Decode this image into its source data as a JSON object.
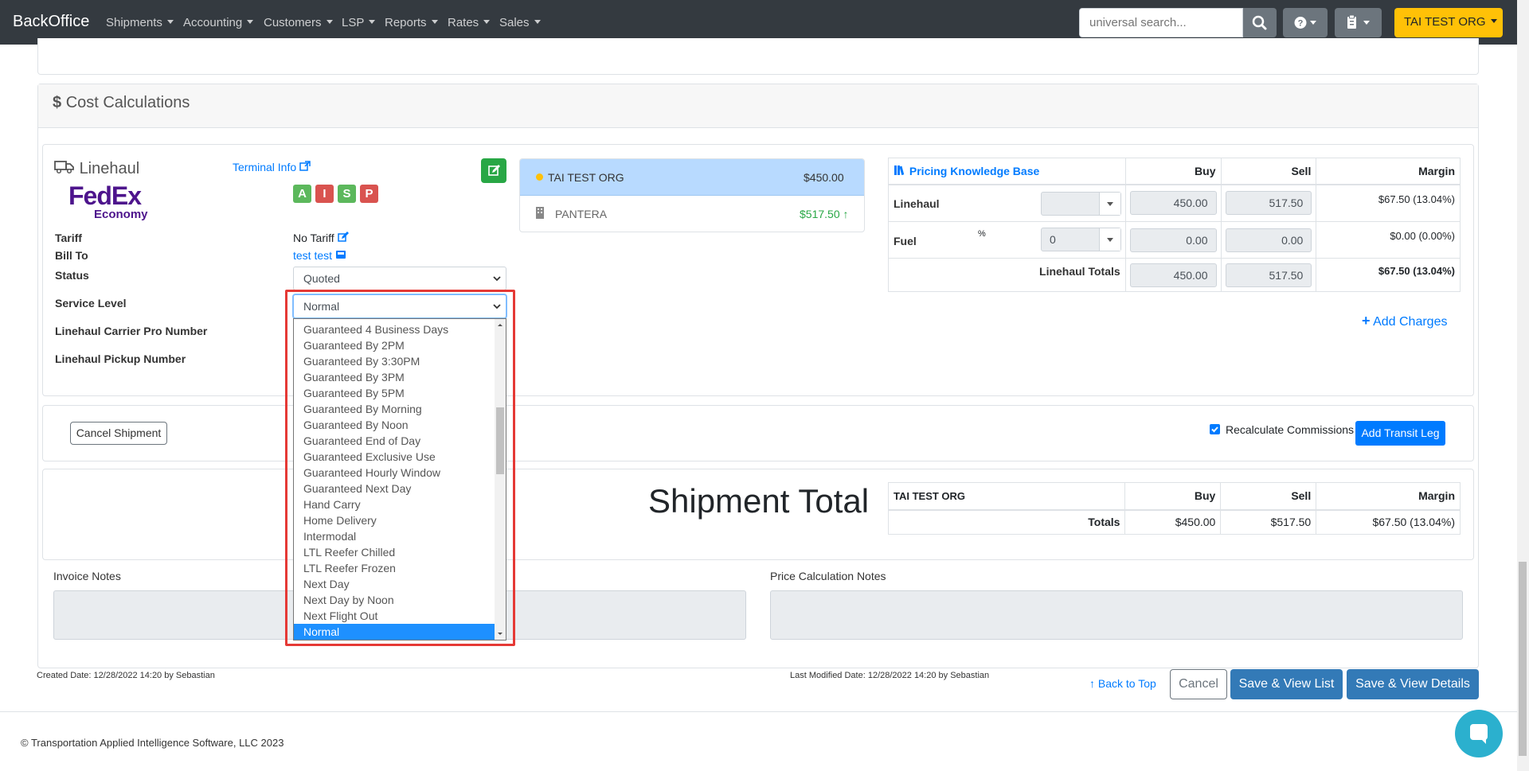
{
  "navbar": {
    "brand": "BackOffice",
    "menu": [
      "Shipments",
      "Accounting",
      "Customers",
      "LSP",
      "Reports",
      "Rates",
      "Sales"
    ],
    "search_placeholder": "universal search...",
    "org": "TAI TEST ORG"
  },
  "cost": {
    "title": "Cost Calculations",
    "section": "Linehaul",
    "terminal_info": "Terminal Info",
    "carrier_logo": {
      "main": "FedEx",
      "sub": "Economy"
    },
    "badges": [
      {
        "letter": "A",
        "color": "#5cb85c"
      },
      {
        "letter": "I",
        "color": "#d9534f"
      },
      {
        "letter": "S",
        "color": "#5cb85c"
      },
      {
        "letter": "P",
        "color": "#d9534f"
      }
    ],
    "labels": {
      "tariff": "Tariff",
      "bill_to": "Bill To",
      "status": "Status",
      "service_level": "Service Level",
      "pro_number": "Linehaul Carrier Pro Number",
      "pickup_number": "Linehaul Pickup Number"
    },
    "values": {
      "tariff": "No Tariff",
      "bill_to": "test test",
      "status": "Quoted",
      "service_level": "Normal"
    }
  },
  "carriers": [
    {
      "name": "TAI TEST ORG",
      "amount": "$450.00"
    },
    {
      "name": "PANTERA",
      "amount": "$517.50"
    }
  ],
  "pricing": {
    "kb_label": "Pricing Knowledge Base",
    "headers": [
      "Buy",
      "Sell",
      "Margin"
    ],
    "rows": [
      {
        "label": "Linehaul",
        "unit": "",
        "select": "",
        "buy": "450.00",
        "sell": "517.50",
        "margin": "$67.50 (13.04%)"
      },
      {
        "label": "Fuel",
        "unit": "%",
        "select": "0",
        "buy": "0.00",
        "sell": "0.00",
        "margin": "$0.00 (0.00%)"
      }
    ],
    "totals": {
      "label": "Linehaul Totals",
      "buy": "450.00",
      "sell": "517.50",
      "margin": "$67.50 (13.04%)"
    },
    "add_charges": "Add Charges"
  },
  "actions": {
    "cancel_shipment": "Cancel Shipment",
    "recalculate": "Recalculate Commissions",
    "add_transit_leg": "Add Transit Leg"
  },
  "shipment_total": {
    "title": "Shipment Total",
    "org": "TAI TEST ORG",
    "headers": [
      "Buy",
      "Sell",
      "Margin"
    ],
    "totals_label": "Totals",
    "buy": "$450.00",
    "sell": "$517.50",
    "margin": "$67.50 (13.04%)"
  },
  "notes": {
    "invoice": "Invoice Notes",
    "price": "Price Calculation Notes"
  },
  "meta": {
    "created": "Created Date: 12/28/2022 14:20 by Sebastian",
    "modified": "Last Modified Date: 12/28/2022 14:20 by Sebastian"
  },
  "footer_actions": {
    "back_to_top": "Back to Top",
    "cancel": "Cancel",
    "save_list": "Save & View List",
    "save_details": "Save & View Details"
  },
  "copyright": "© Transportation Applied Intelligence Software, LLC 2023",
  "dropdown": {
    "options": [
      "Guaranteed 4 Business Days",
      "Guaranteed By 2PM",
      "Guaranteed By 3:30PM",
      "Guaranteed By 3PM",
      "Guaranteed By 5PM",
      "Guaranteed By Morning",
      "Guaranteed By Noon",
      "Guaranteed End of Day",
      "Guaranteed Exclusive Use",
      "Guaranteed Hourly Window",
      "Guaranteed Next Day",
      "Hand Carry",
      "Home Delivery",
      "Intermodal",
      "LTL Reefer Chilled",
      "LTL Reefer Frozen",
      "Next Day",
      "Next Day by Noon",
      "Next Flight Out",
      "Normal"
    ],
    "selected": "Normal"
  },
  "colors": {
    "highlight": "#e53935",
    "primary": "#007bff",
    "warning": "#ffc107",
    "success": "#28a745"
  }
}
